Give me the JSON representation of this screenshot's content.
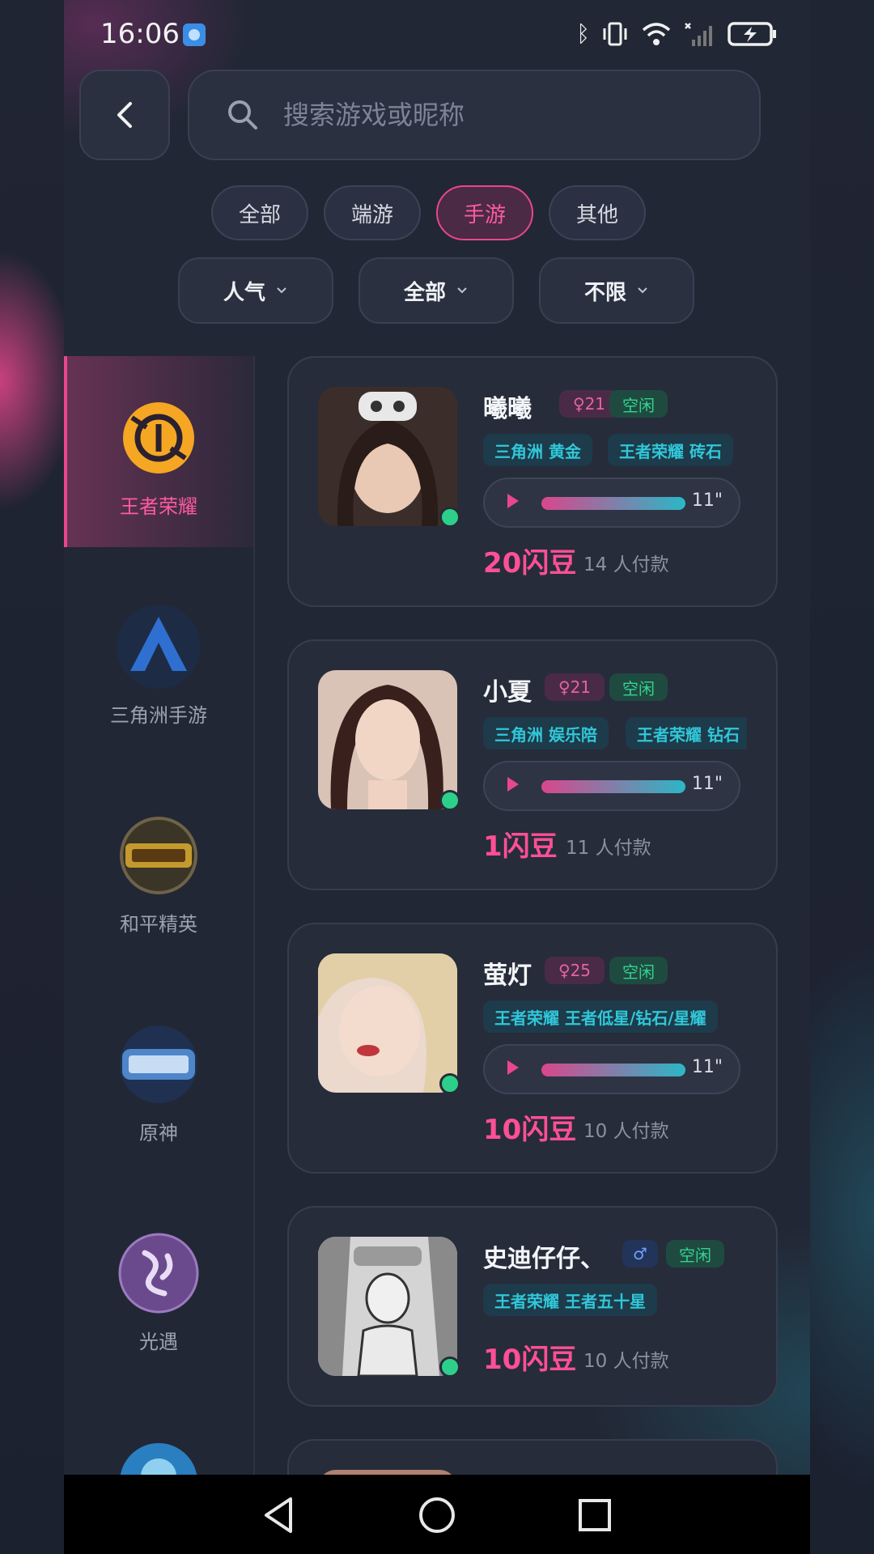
{
  "status_bar": {
    "time": "16:06"
  },
  "search": {
    "placeholder": "搜索游戏或昵称"
  },
  "category_tabs": [
    {
      "label": "全部",
      "active": false
    },
    {
      "label": "端游",
      "active": false
    },
    {
      "label": "手游",
      "active": true
    },
    {
      "label": "其他",
      "active": false
    }
  ],
  "filters": [
    {
      "label": "人气"
    },
    {
      "label": "全部"
    },
    {
      "label": "不限"
    }
  ],
  "sidebar": {
    "items": [
      {
        "label": "王者荣耀",
        "active": true
      },
      {
        "label": "三角洲手游",
        "active": false
      },
      {
        "label": "和平精英",
        "active": false
      },
      {
        "label": "原神",
        "active": false
      },
      {
        "label": "光遇",
        "active": false
      },
      {
        "label": "",
        "active": false
      }
    ]
  },
  "players": [
    {
      "name": "曦曦",
      "gender": "♀21",
      "status": "空闲",
      "tags": [
        "三角洲 黄金",
        "王者荣耀 砖石"
      ],
      "voice_duration": "11\"",
      "price": "20闪豆",
      "paid": "14 人付款"
    },
    {
      "name": "小夏",
      "gender": "♀21",
      "status": "空闲",
      "tags": [
        "三角洲 娱乐陪",
        "王者荣耀 钻石"
      ],
      "voice_duration": "11\"",
      "price": "1闪豆",
      "paid": "11 人付款"
    },
    {
      "name": "萤灯",
      "gender": "♀25",
      "status": "空闲",
      "tags": [
        "王者荣耀 王者低星/钻石/星耀"
      ],
      "voice_duration": "11\"",
      "price": "10闪豆",
      "paid": "10 人付款"
    },
    {
      "name": "史迪仔仔、",
      "gender": "♂",
      "status": "空闲",
      "tags": [
        "王者荣耀 王者五十星"
      ],
      "price": "10闪豆",
      "paid": "10 人付款"
    }
  ],
  "colors": {
    "accent": "#e8478c",
    "online": "#2dd08a",
    "tag_text": "#30c7d9"
  }
}
